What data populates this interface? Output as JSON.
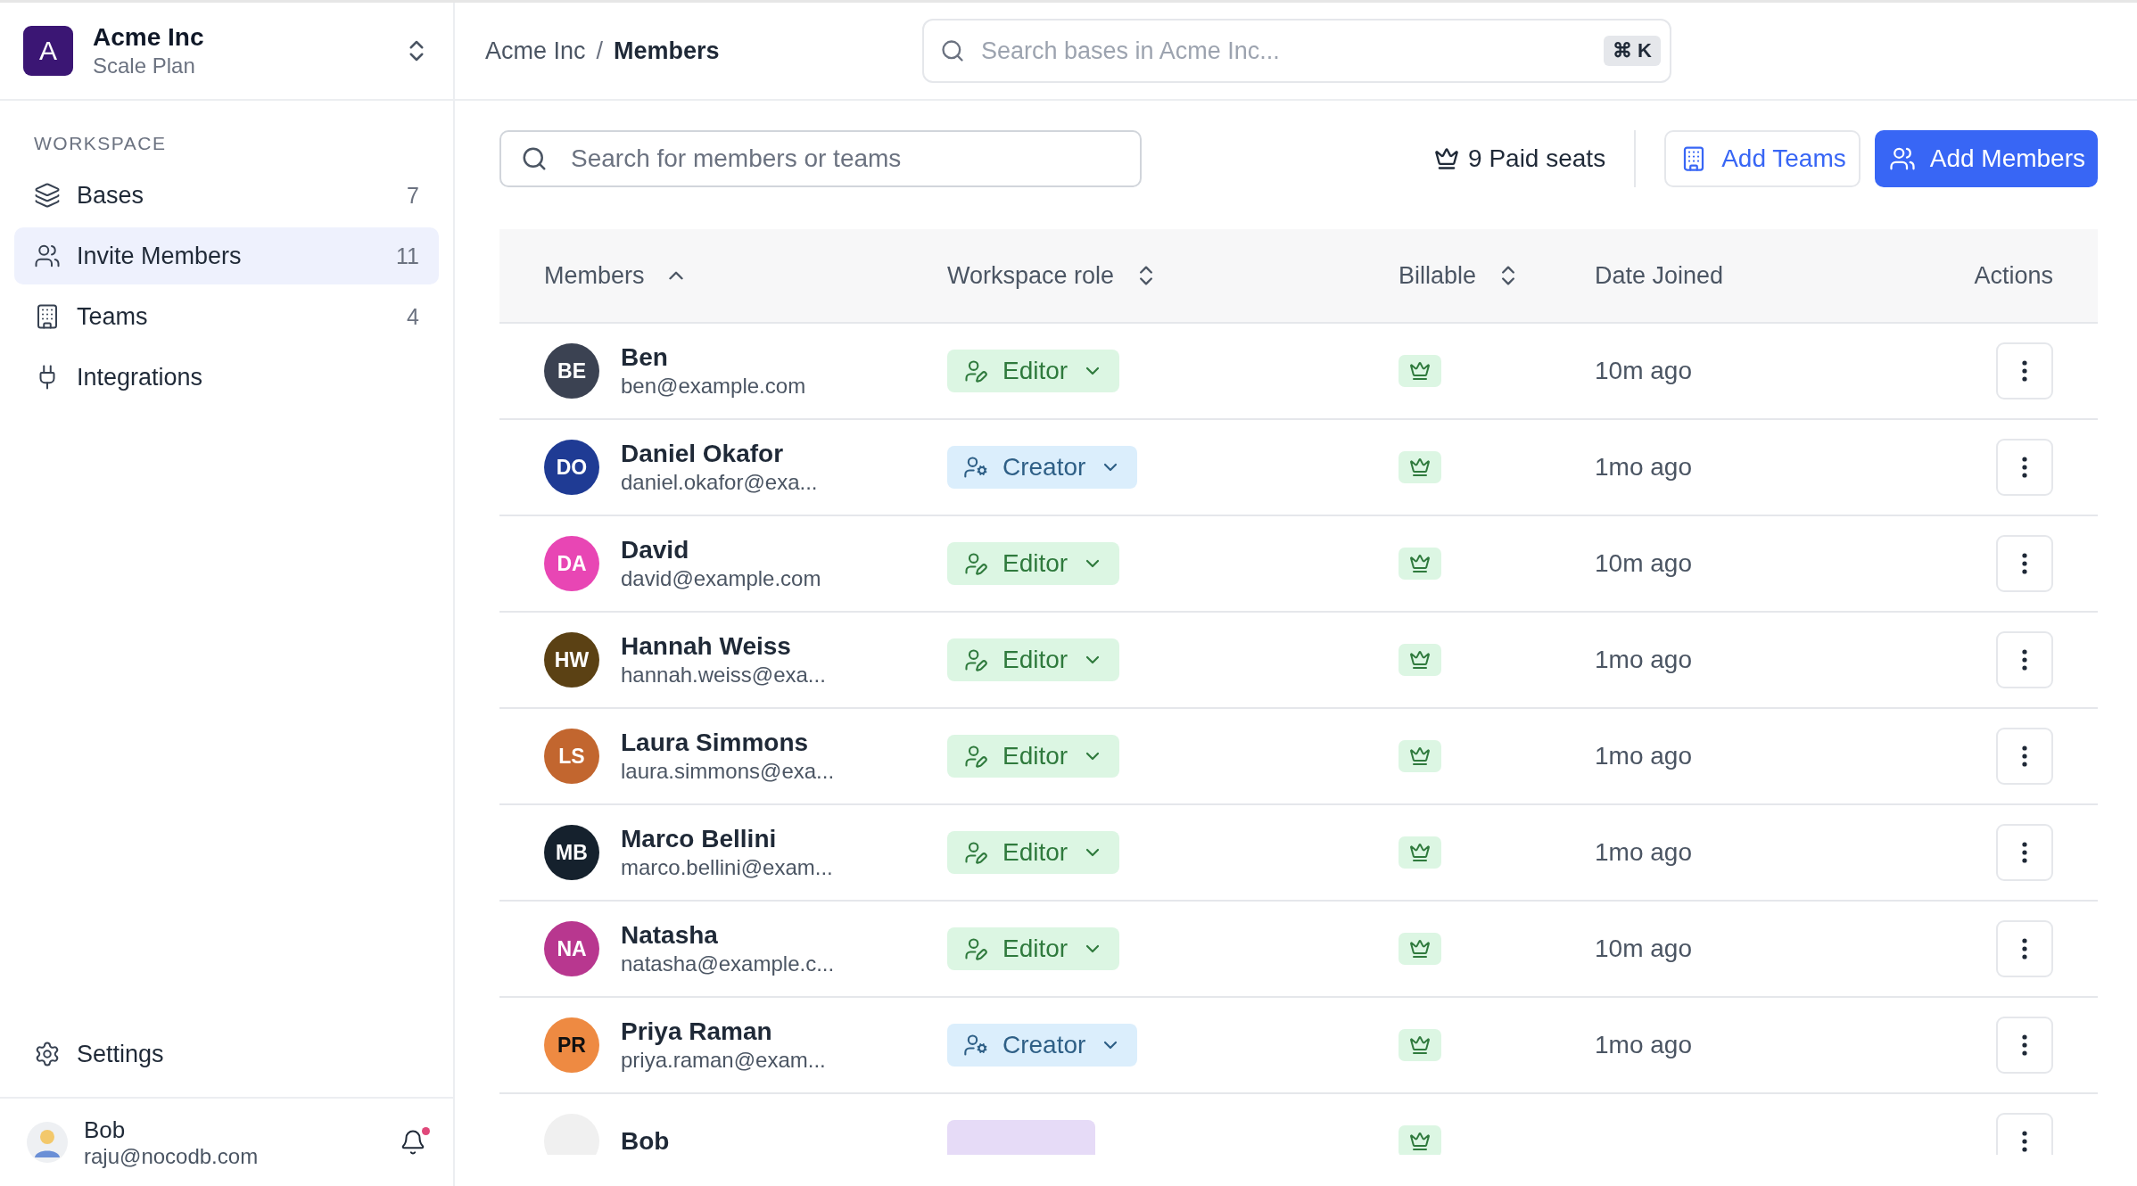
{
  "workspace": {
    "initial": "A",
    "name": "Acme Inc",
    "plan": "Scale Plan"
  },
  "sidebar": {
    "section": "WORKSPACE",
    "items": [
      {
        "label": "Bases",
        "count": "7",
        "kind": "layers",
        "selected": false
      },
      {
        "label": "Invite Members",
        "count": "11",
        "kind": "users",
        "selected": true
      },
      {
        "label": "Teams",
        "count": "4",
        "kind": "building",
        "selected": false
      },
      {
        "label": "Integrations",
        "kind": "plug",
        "selected": false
      }
    ],
    "settings": "Settings",
    "user": {
      "name": "Bob",
      "email": "raju@nocodb.com",
      "unread": true
    }
  },
  "breadcrumb": {
    "separator": "/",
    "items": [
      {
        "label": "Acme Inc",
        "current": false
      },
      {
        "label": "Members",
        "current": true
      }
    ]
  },
  "global_search": {
    "placeholder": "Search bases in Acme Inc...",
    "shortcut": "⌘ K"
  },
  "toolbar": {
    "search_placeholder": "Search for members or teams",
    "seats": "9 Paid seats",
    "buttons": [
      {
        "label": "Add Teams",
        "kind": "secondary"
      },
      {
        "label": "Add Members",
        "kind": "primary"
      }
    ]
  },
  "table": {
    "columns": [
      {
        "label": "Members",
        "kind": "ascending"
      },
      {
        "label": "Workspace role",
        "kind": "sortable"
      },
      {
        "label": "Billable",
        "kind": "sortable"
      },
      {
        "label": "Date Joined",
        "kind": "plain"
      },
      {
        "label": "Actions",
        "kind": "plain"
      }
    ],
    "rows": [
      {
        "initials": "BE",
        "color": "#3b4252",
        "name": "Ben",
        "email": "ben@example.com",
        "role": {
          "label": "Editor",
          "kind": "editor"
        },
        "billable": true,
        "joined": "10m ago"
      },
      {
        "initials": "DO",
        "color": "#1f3b94",
        "name": "Daniel Okafor",
        "email": "daniel.okafor@exa...",
        "role": {
          "label": "Creator",
          "kind": "creator"
        },
        "billable": true,
        "joined": "1mo ago"
      },
      {
        "initials": "DA",
        "color": "#e846b4",
        "name": "David",
        "email": "david@example.com",
        "role": {
          "label": "Editor",
          "kind": "editor"
        },
        "billable": true,
        "joined": "10m ago"
      },
      {
        "initials": "HW",
        "color": "#5b4114",
        "name": "Hannah Weiss",
        "email": "hannah.weiss@exa...",
        "role": {
          "label": "Editor",
          "kind": "editor"
        },
        "billable": true,
        "joined": "1mo ago"
      },
      {
        "initials": "LS",
        "color": "#c2662f",
        "name": "Laura Simmons",
        "email": "laura.simmons@exa...",
        "role": {
          "label": "Editor",
          "kind": "editor"
        },
        "billable": true,
        "joined": "1mo ago"
      },
      {
        "initials": "MB",
        "color": "#15212d",
        "name": "Marco Bellini",
        "email": "marco.bellini@exam...",
        "role": {
          "label": "Editor",
          "kind": "editor"
        },
        "billable": true,
        "joined": "1mo ago"
      },
      {
        "initials": "NA",
        "color": "#b8378f",
        "name": "Natasha",
        "email": "natasha@example.c...",
        "role": {
          "label": "Editor",
          "kind": "editor"
        },
        "billable": true,
        "joined": "10m ago"
      },
      {
        "initials": "PR",
        "color": "#ee8a42",
        "name": "Priya Raman",
        "email": "priya.raman@exam...",
        "role": {
          "label": "Creator",
          "kind": "creator"
        },
        "billable": true,
        "joined": "1mo ago"
      },
      {
        "initials": "",
        "color": "#f0f0f0",
        "name": "Bob",
        "role": {
          "kind": "owner"
        },
        "billable": true
      }
    ]
  }
}
